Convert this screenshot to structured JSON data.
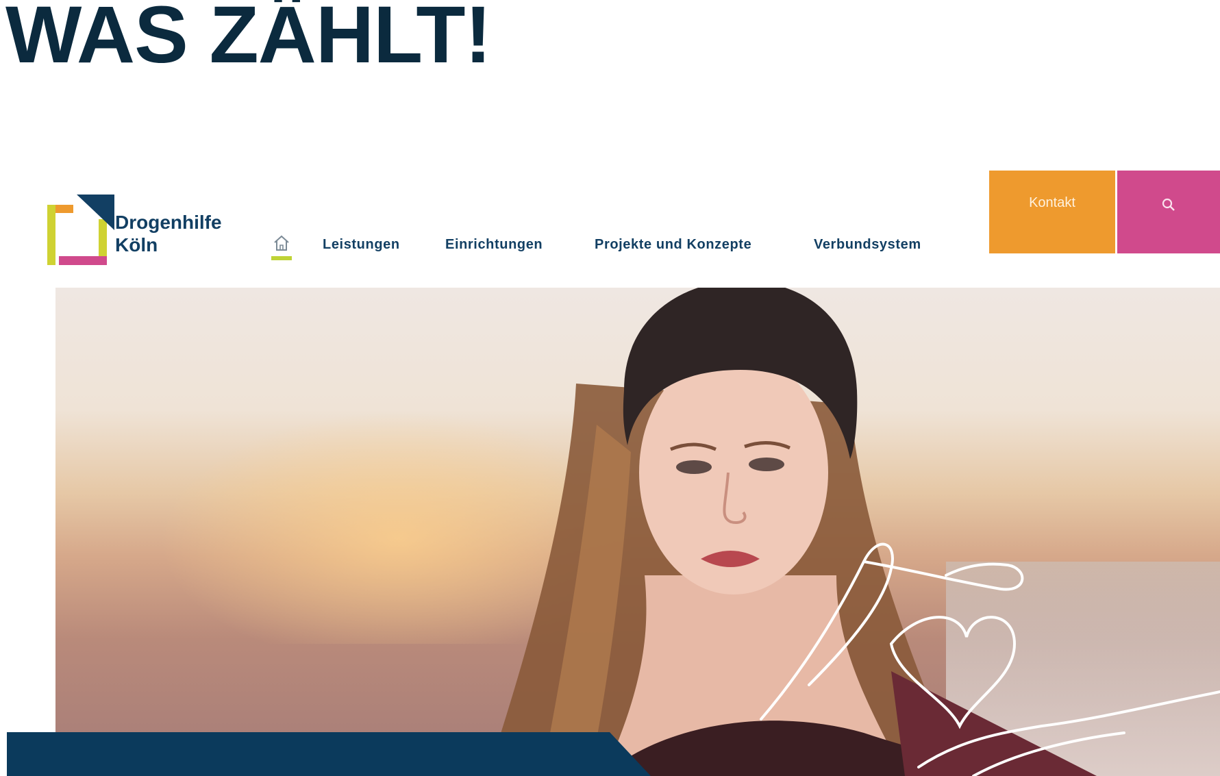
{
  "headline": "WAS ZÄHLT!",
  "logo": {
    "line1": "Drogenhilfe",
    "line2": "Köln"
  },
  "nav": {
    "items": [
      {
        "label": "Leistungen"
      },
      {
        "label": "Einrichtungen"
      },
      {
        "label": "Projekte und Konzepte"
      },
      {
        "label": "Verbundsystem"
      }
    ],
    "kontakt_label": "Kontakt"
  },
  "icons": {
    "home": "home-icon",
    "search": "search-icon"
  },
  "colors": {
    "navy": "#123f63",
    "orange": "#ee9a2e",
    "pink": "#d04a8c",
    "lime": "#cfd233",
    "headline": "#0b2a3e",
    "strip": "#0b3a5c"
  }
}
